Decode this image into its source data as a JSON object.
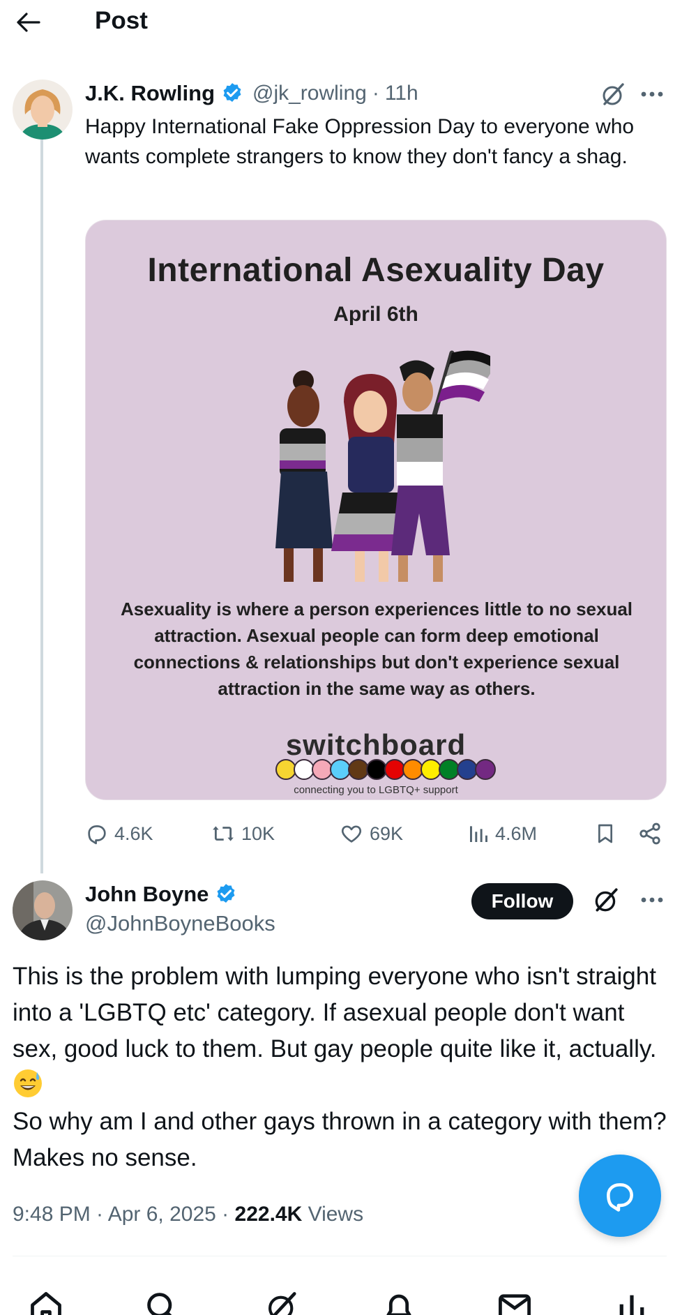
{
  "header": {
    "title": "Post",
    "back_icon": "arrow-left-icon"
  },
  "tweet": {
    "author": {
      "display_name": "J.K. Rowling",
      "handle": "@jk_rowling",
      "verified": true
    },
    "time": "11h",
    "separator": "·",
    "text": "Happy International Fake Oppression Day to everyone who wants complete strangers to know they don't fancy a shag.",
    "media": {
      "title": "International Asexuality Day",
      "date": "April 6th",
      "description": "Asexuality is where a person experiences little to no sexual attraction. Asexual people can form deep emotional connections & relationships but don't experience sexual attraction in the same way as others.",
      "brand": "switchboard",
      "tagline": "connecting you to LGBTQ+ support",
      "background": "#dccadc",
      "dot_colors": [
        "#f6d531",
        "#ffffff",
        "#f5a9b8",
        "#5bcefa",
        "#613915",
        "#000000",
        "#e40303",
        "#ff8c00",
        "#ffed00",
        "#008026",
        "#24408e",
        "#732982"
      ]
    },
    "stats": {
      "replies": "4.6K",
      "reposts": "10K",
      "likes": "69K",
      "views": "4.6M"
    }
  },
  "reply": {
    "author": {
      "display_name": "John Boyne",
      "handle": "@JohnBoyneBooks",
      "verified": true
    },
    "follow_label": "Follow",
    "text_part1": "This is the problem with lumping everyone who isn't straight into a 'LGBTQ etc' category. If asexual people don't want sex, good luck to them. But gay people quite like it, actually.",
    "text_part2": "\nSo why am I and other gays thrown in a category with them? Makes no sense.",
    "emoji": "sweat-smile-emoji",
    "timestamp": "9:48 PM · Apr 6, 2025 · ",
    "views_count": "222.4K",
    "views_label": " Views"
  },
  "nav": {
    "items": [
      "home-icon",
      "search-icon",
      "grok-icon",
      "notifications-icon",
      "messages-icon",
      "grok-more-icon"
    ]
  },
  "colors": {
    "accent": "#1d9bf0",
    "text": "#0f1419",
    "secondary": "#536471",
    "divider": "#cfd9de"
  }
}
